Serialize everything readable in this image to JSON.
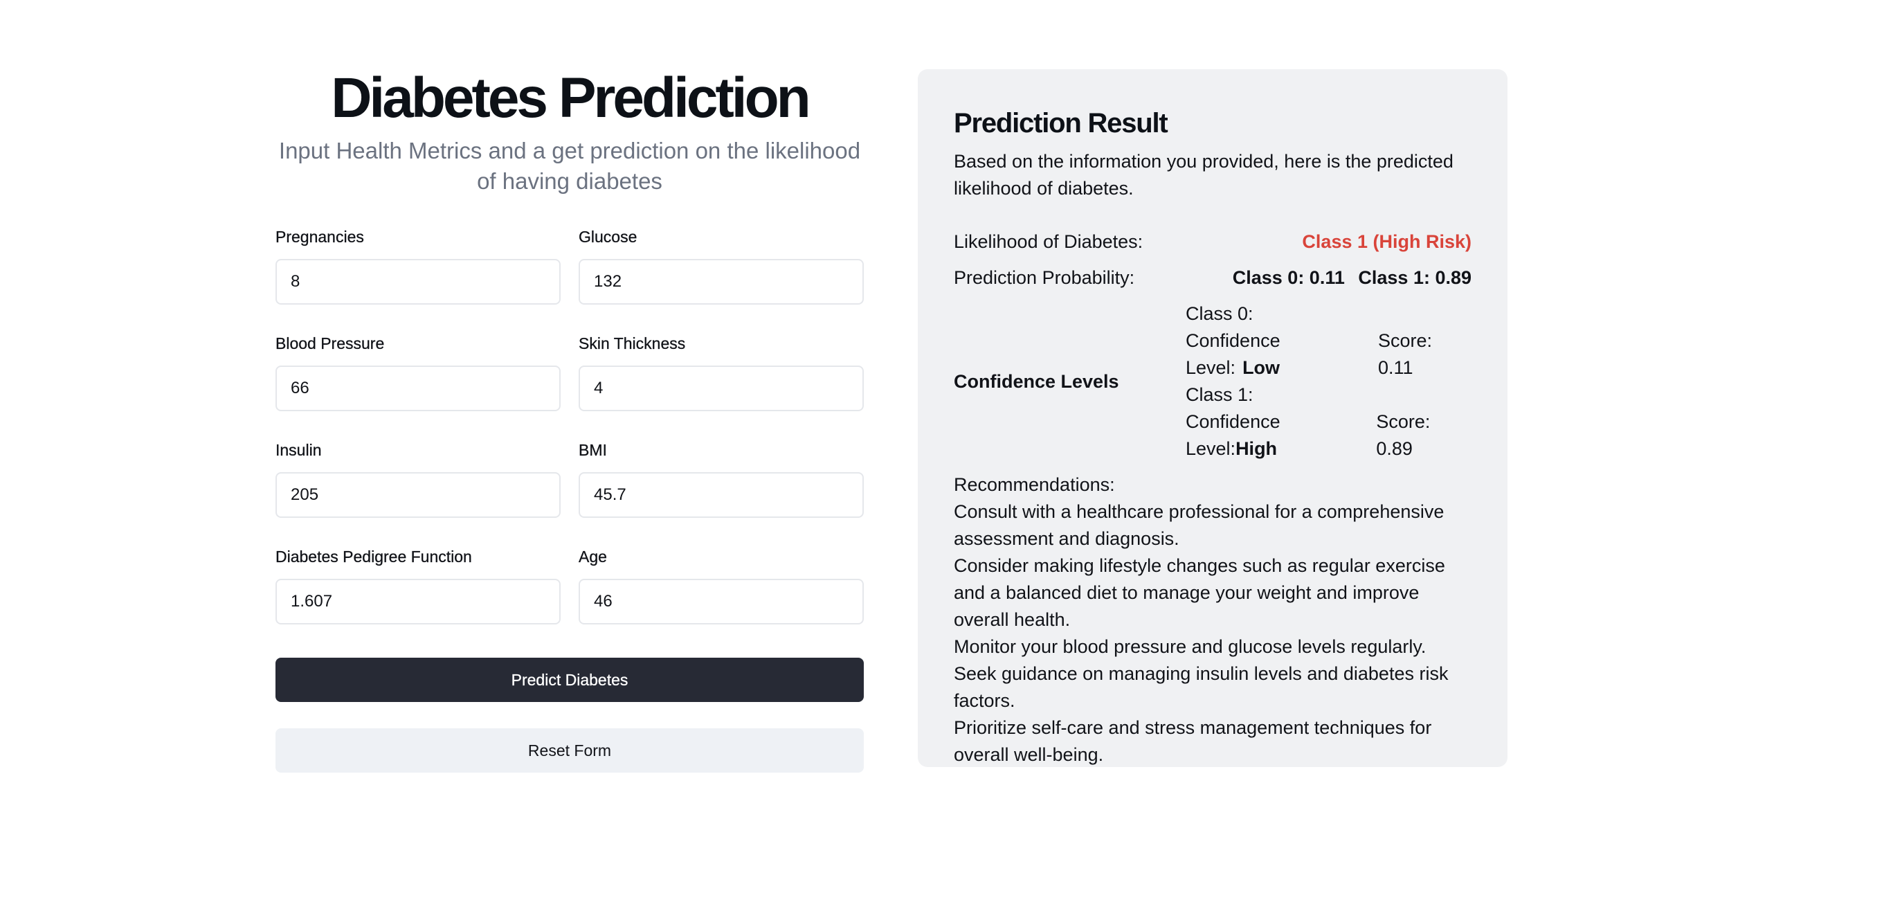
{
  "form": {
    "title": "Diabetes Prediction",
    "subtitle": "Input Health Metrics and a get prediction on the likelihood of having diabetes",
    "fields": [
      {
        "label": "Pregnancies",
        "value": "8"
      },
      {
        "label": "Glucose",
        "value": "132"
      },
      {
        "label": "Blood Pressure",
        "value": "66"
      },
      {
        "label": "Skin Thickness",
        "value": "4"
      },
      {
        "label": "Insulin",
        "value": "205"
      },
      {
        "label": "BMI",
        "value": "45.7"
      },
      {
        "label": "Diabetes Pedigree Function",
        "value": "1.607"
      },
      {
        "label": "Age",
        "value": "46"
      }
    ],
    "predict_label": "Predict Diabetes",
    "reset_label": "Reset Form"
  },
  "result": {
    "title": "Prediction Result",
    "intro": "Based on the information you provided, here is the predicted likelihood of diabetes.",
    "likelihood_label": "Likelihood of Diabetes:",
    "likelihood_value": "Class 1 (High Risk)",
    "probability_label": "Prediction Probability:",
    "probability_class0": "Class 0: 0.11",
    "probability_class1": "Class 1: 0.89",
    "confidence_heading": "Confidence Levels",
    "confidence": [
      {
        "class_label": "Class 0:",
        "level_label": "Confidence Level:",
        "level": "Low",
        "score": "Score: 0.11"
      },
      {
        "class_label": "Class 1:",
        "level_label": "Confidence Level:",
        "level": "High",
        "score": "Score: 0.89"
      }
    ],
    "recommendations_label": "Recommendations:",
    "recommendations": [
      "Consult with a healthcare professional for a comprehensive assessment and diagnosis.",
      "Consider making lifestyle changes such as regular exercise and a balanced diet to manage your weight and improve overall health.",
      "Monitor your blood pressure and glucose levels regularly.",
      "Seek guidance on managing insulin levels and diabetes risk factors.",
      "Prioritize self-care and stress management techniques for overall well-being."
    ],
    "colors": {
      "high_risk": "#d9443a",
      "panel_bg": "#f0f1f3",
      "primary_button": "#272a35"
    }
  }
}
